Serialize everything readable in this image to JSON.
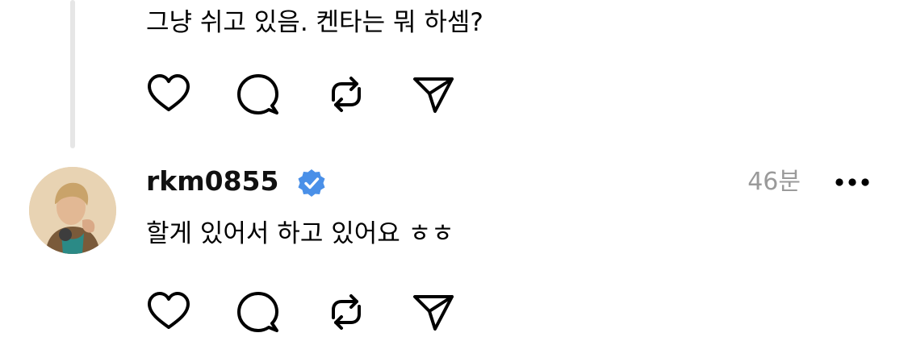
{
  "parent_post": {
    "text": "그냥 쉬고 있음. 켄타는 뭐 하셈?"
  },
  "reply": {
    "username": "rkm0855",
    "verified": true,
    "time": "46분",
    "text": "할게 있어서 하고 있어요 ㅎㅎ"
  },
  "actions": [
    {
      "name": "like",
      "icon": "heart-icon"
    },
    {
      "name": "reply",
      "icon": "comment-icon"
    },
    {
      "name": "repost",
      "icon": "repost-icon"
    },
    {
      "name": "share",
      "icon": "send-icon"
    }
  ],
  "colors": {
    "verified_badge": "#4a90e8",
    "timestamp": "#9a9a9a",
    "thread_line": "#e6e6e6"
  }
}
